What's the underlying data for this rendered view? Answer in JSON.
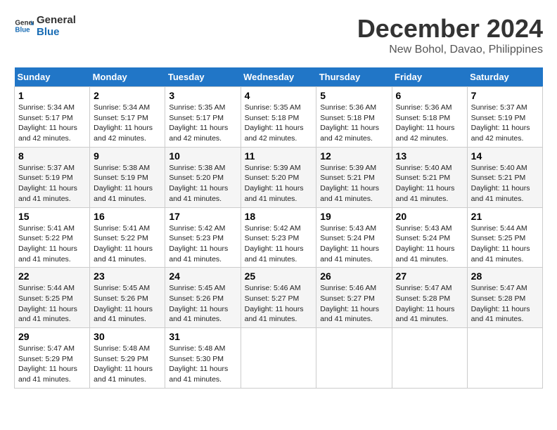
{
  "logo": {
    "text_general": "General",
    "text_blue": "Blue"
  },
  "title": "December 2024",
  "subtitle": "New Bohol, Davao, Philippines",
  "weekdays": [
    "Sunday",
    "Monday",
    "Tuesday",
    "Wednesday",
    "Thursday",
    "Friday",
    "Saturday"
  ],
  "weeks": [
    [
      {
        "day": "1",
        "info": "Sunrise: 5:34 AM\nSunset: 5:17 PM\nDaylight: 11 hours\nand 42 minutes."
      },
      {
        "day": "2",
        "info": "Sunrise: 5:34 AM\nSunset: 5:17 PM\nDaylight: 11 hours\nand 42 minutes."
      },
      {
        "day": "3",
        "info": "Sunrise: 5:35 AM\nSunset: 5:17 PM\nDaylight: 11 hours\nand 42 minutes."
      },
      {
        "day": "4",
        "info": "Sunrise: 5:35 AM\nSunset: 5:18 PM\nDaylight: 11 hours\nand 42 minutes."
      },
      {
        "day": "5",
        "info": "Sunrise: 5:36 AM\nSunset: 5:18 PM\nDaylight: 11 hours\nand 42 minutes."
      },
      {
        "day": "6",
        "info": "Sunrise: 5:36 AM\nSunset: 5:18 PM\nDaylight: 11 hours\nand 42 minutes."
      },
      {
        "day": "7",
        "info": "Sunrise: 5:37 AM\nSunset: 5:19 PM\nDaylight: 11 hours\nand 42 minutes."
      }
    ],
    [
      {
        "day": "8",
        "info": "Sunrise: 5:37 AM\nSunset: 5:19 PM\nDaylight: 11 hours\nand 41 minutes."
      },
      {
        "day": "9",
        "info": "Sunrise: 5:38 AM\nSunset: 5:19 PM\nDaylight: 11 hours\nand 41 minutes."
      },
      {
        "day": "10",
        "info": "Sunrise: 5:38 AM\nSunset: 5:20 PM\nDaylight: 11 hours\nand 41 minutes."
      },
      {
        "day": "11",
        "info": "Sunrise: 5:39 AM\nSunset: 5:20 PM\nDaylight: 11 hours\nand 41 minutes."
      },
      {
        "day": "12",
        "info": "Sunrise: 5:39 AM\nSunset: 5:21 PM\nDaylight: 11 hours\nand 41 minutes."
      },
      {
        "day": "13",
        "info": "Sunrise: 5:40 AM\nSunset: 5:21 PM\nDaylight: 11 hours\nand 41 minutes."
      },
      {
        "day": "14",
        "info": "Sunrise: 5:40 AM\nSunset: 5:21 PM\nDaylight: 11 hours\nand 41 minutes."
      }
    ],
    [
      {
        "day": "15",
        "info": "Sunrise: 5:41 AM\nSunset: 5:22 PM\nDaylight: 11 hours\nand 41 minutes."
      },
      {
        "day": "16",
        "info": "Sunrise: 5:41 AM\nSunset: 5:22 PM\nDaylight: 11 hours\nand 41 minutes."
      },
      {
        "day": "17",
        "info": "Sunrise: 5:42 AM\nSunset: 5:23 PM\nDaylight: 11 hours\nand 41 minutes."
      },
      {
        "day": "18",
        "info": "Sunrise: 5:42 AM\nSunset: 5:23 PM\nDaylight: 11 hours\nand 41 minutes."
      },
      {
        "day": "19",
        "info": "Sunrise: 5:43 AM\nSunset: 5:24 PM\nDaylight: 11 hours\nand 41 minutes."
      },
      {
        "day": "20",
        "info": "Sunrise: 5:43 AM\nSunset: 5:24 PM\nDaylight: 11 hours\nand 41 minutes."
      },
      {
        "day": "21",
        "info": "Sunrise: 5:44 AM\nSunset: 5:25 PM\nDaylight: 11 hours\nand 41 minutes."
      }
    ],
    [
      {
        "day": "22",
        "info": "Sunrise: 5:44 AM\nSunset: 5:25 PM\nDaylight: 11 hours\nand 41 minutes."
      },
      {
        "day": "23",
        "info": "Sunrise: 5:45 AM\nSunset: 5:26 PM\nDaylight: 11 hours\nand 41 minutes."
      },
      {
        "day": "24",
        "info": "Sunrise: 5:45 AM\nSunset: 5:26 PM\nDaylight: 11 hours\nand 41 minutes."
      },
      {
        "day": "25",
        "info": "Sunrise: 5:46 AM\nSunset: 5:27 PM\nDaylight: 11 hours\nand 41 minutes."
      },
      {
        "day": "26",
        "info": "Sunrise: 5:46 AM\nSunset: 5:27 PM\nDaylight: 11 hours\nand 41 minutes."
      },
      {
        "day": "27",
        "info": "Sunrise: 5:47 AM\nSunset: 5:28 PM\nDaylight: 11 hours\nand 41 minutes."
      },
      {
        "day": "28",
        "info": "Sunrise: 5:47 AM\nSunset: 5:28 PM\nDaylight: 11 hours\nand 41 minutes."
      }
    ],
    [
      {
        "day": "29",
        "info": "Sunrise: 5:47 AM\nSunset: 5:29 PM\nDaylight: 11 hours\nand 41 minutes."
      },
      {
        "day": "30",
        "info": "Sunrise: 5:48 AM\nSunset: 5:29 PM\nDaylight: 11 hours\nand 41 minutes."
      },
      {
        "day": "31",
        "info": "Sunrise: 5:48 AM\nSunset: 5:30 PM\nDaylight: 11 hours\nand 41 minutes."
      },
      null,
      null,
      null,
      null
    ]
  ]
}
